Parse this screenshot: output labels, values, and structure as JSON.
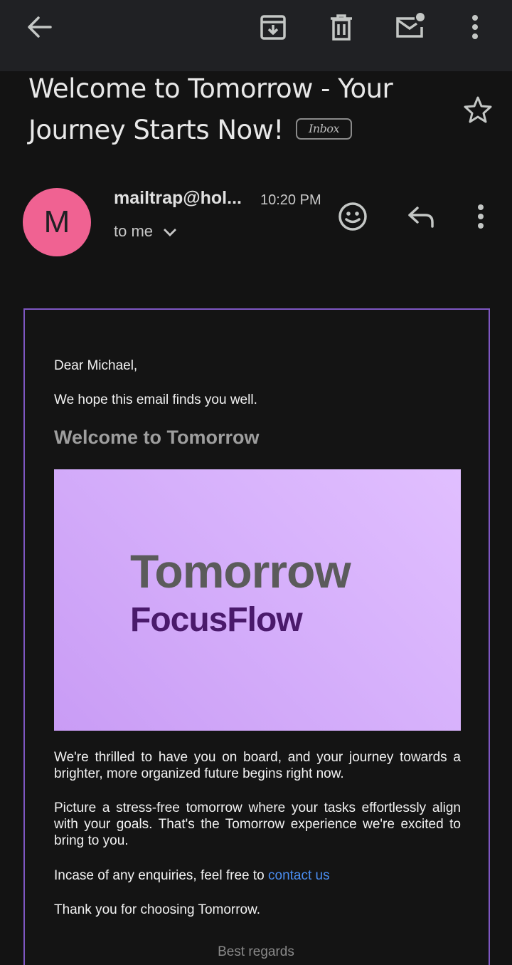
{
  "subject": {
    "title": "Welcome to Tomorrow - Your Journey Starts Now!",
    "label": "Inbox"
  },
  "sender": {
    "avatar_letter": "M",
    "avatar_color": "#f06292",
    "name": "mailtrap@hol...",
    "time": "10:20 PM",
    "recipient": "to me"
  },
  "body": {
    "greeting": "Dear Michael,",
    "intro": "We hope this email finds you well.",
    "heading": "Welcome to Tomorrow",
    "banner": {
      "brand": "Tomorrow",
      "product": "FocusFlow"
    },
    "paragraph1": "We're thrilled to have you on board, and your journey towards a brighter, more organized future begins right now.",
    "paragraph2": "Picture a stress-free tomorrow where your tasks effortlessly align with your goals. That's the Tomorrow experience we're excited to bring to you.",
    "enquiry_text": "Incase of any enquiries, feel free to ",
    "contact_link": "contact us",
    "thanks": "Thank you for choosing Tomorrow.",
    "regards": "Best regards"
  },
  "icons": {
    "back": "arrow-left-icon",
    "archive": "archive-icon",
    "delete": "trash-icon",
    "unread": "mark-unread-icon",
    "more": "more-vert-icon",
    "star": "star-icon",
    "react": "emoji-icon",
    "reply": "reply-icon"
  },
  "colors": {
    "accent_border": "#7e57c2",
    "link": "#4a8df0",
    "banner": "#d6b0fb"
  }
}
